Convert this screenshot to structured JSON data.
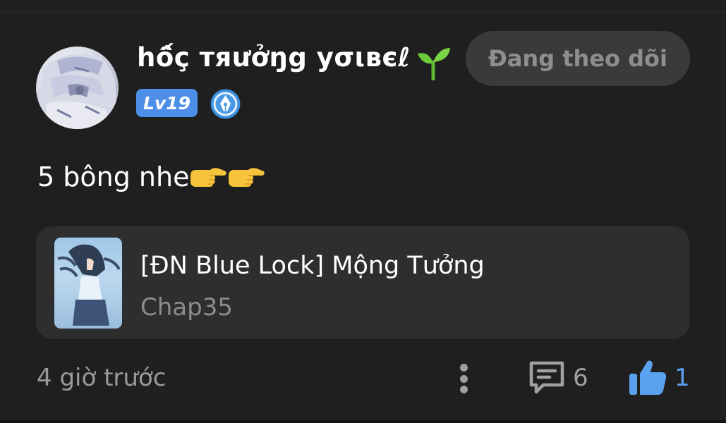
{
  "post": {
    "user": {
      "name": "hố̂ç тяư̛ởŋg уσιвєℓ",
      "level_badge": "Lv19",
      "badge_icon": "pen-nib-icon",
      "decoration_icon": "sprout-icon"
    },
    "follow_button_label": "Đang theo dõi",
    "comment_text": "5 bông nhe",
    "comment_emoji": "pointing-finger-icon",
    "story": {
      "title": "[ĐN Blue Lock] Mộng Tưởng",
      "chapter": "Chap35"
    },
    "timestamp": "4 giờ trước",
    "comment_count": "6",
    "like_count": "1"
  },
  "colors": {
    "background": "#1f1f1f",
    "card": "#2e2e2e",
    "accent_blue": "#4d8fe8",
    "like_blue": "#5aa2f0",
    "muted_text": "#9a9a9a"
  }
}
